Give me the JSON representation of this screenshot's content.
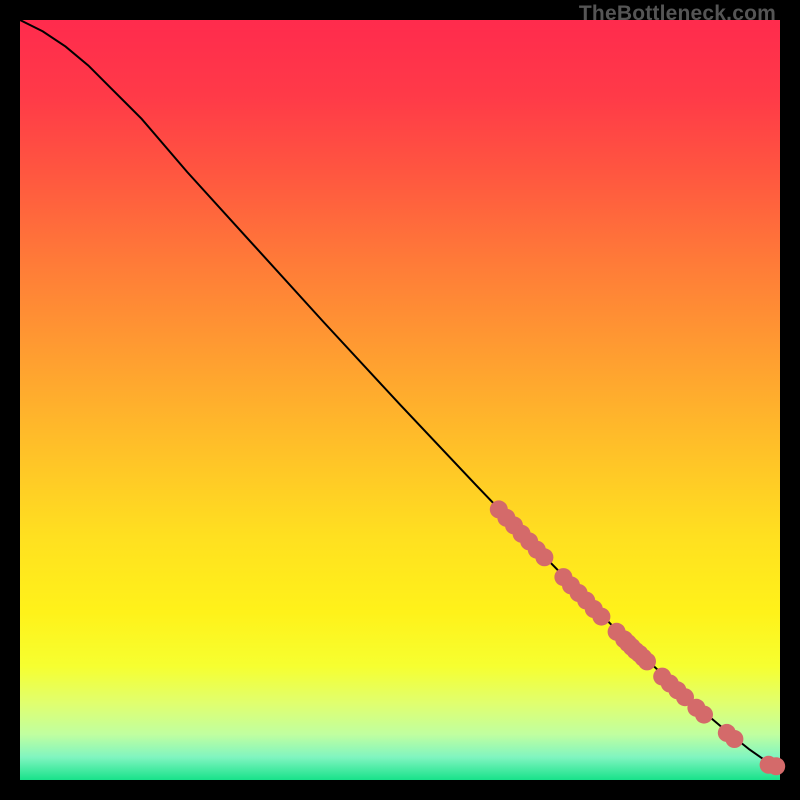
{
  "watermark": "TheBottleneck.com",
  "chart_data": {
    "type": "line",
    "title": "",
    "xlabel": "",
    "ylabel": "",
    "xlim": [
      0,
      100
    ],
    "ylim": [
      0,
      100
    ],
    "curve": [
      {
        "x": 0,
        "y": 100
      },
      {
        "x": 3,
        "y": 98.5
      },
      {
        "x": 6,
        "y": 96.5
      },
      {
        "x": 9,
        "y": 94
      },
      {
        "x": 12,
        "y": 91
      },
      {
        "x": 16,
        "y": 87
      },
      {
        "x": 22,
        "y": 80
      },
      {
        "x": 30,
        "y": 71.2
      },
      {
        "x": 40,
        "y": 60.2
      },
      {
        "x": 50,
        "y": 49.4
      },
      {
        "x": 60,
        "y": 38.8
      },
      {
        "x": 70,
        "y": 28.4
      },
      {
        "x": 80,
        "y": 18.2
      },
      {
        "x": 88,
        "y": 10.6
      },
      {
        "x": 93,
        "y": 6.4
      },
      {
        "x": 96,
        "y": 4.0
      },
      {
        "x": 98,
        "y": 2.6
      },
      {
        "x": 100,
        "y": 1.8
      }
    ],
    "points": [
      {
        "x": 63.0,
        "y": 35.6
      },
      {
        "x": 64.0,
        "y": 34.5
      },
      {
        "x": 65.0,
        "y": 33.5
      },
      {
        "x": 66.0,
        "y": 32.4
      },
      {
        "x": 67.0,
        "y": 31.4
      },
      {
        "x": 68.0,
        "y": 30.3
      },
      {
        "x": 69.0,
        "y": 29.3
      },
      {
        "x": 71.5,
        "y": 26.7
      },
      {
        "x": 72.5,
        "y": 25.6
      },
      {
        "x": 73.5,
        "y": 24.6
      },
      {
        "x": 74.5,
        "y": 23.6
      },
      {
        "x": 75.5,
        "y": 22.5
      },
      {
        "x": 76.5,
        "y": 21.5
      },
      {
        "x": 78.5,
        "y": 19.5
      },
      {
        "x": 79.5,
        "y": 18.5
      },
      {
        "x": 80.0,
        "y": 18.0
      },
      {
        "x": 80.5,
        "y": 17.5
      },
      {
        "x": 81.0,
        "y": 17.0
      },
      {
        "x": 81.5,
        "y": 16.6
      },
      {
        "x": 82.0,
        "y": 16.1
      },
      {
        "x": 82.5,
        "y": 15.6
      },
      {
        "x": 84.5,
        "y": 13.6
      },
      {
        "x": 85.5,
        "y": 12.7
      },
      {
        "x": 86.5,
        "y": 11.8
      },
      {
        "x": 87.5,
        "y": 10.9
      },
      {
        "x": 89.0,
        "y": 9.5
      },
      {
        "x": 90.0,
        "y": 8.6
      },
      {
        "x": 93.0,
        "y": 6.2
      },
      {
        "x": 94.0,
        "y": 5.4
      },
      {
        "x": 98.5,
        "y": 2.0
      },
      {
        "x": 99.5,
        "y": 1.8
      }
    ],
    "point_radius_px": 9
  }
}
